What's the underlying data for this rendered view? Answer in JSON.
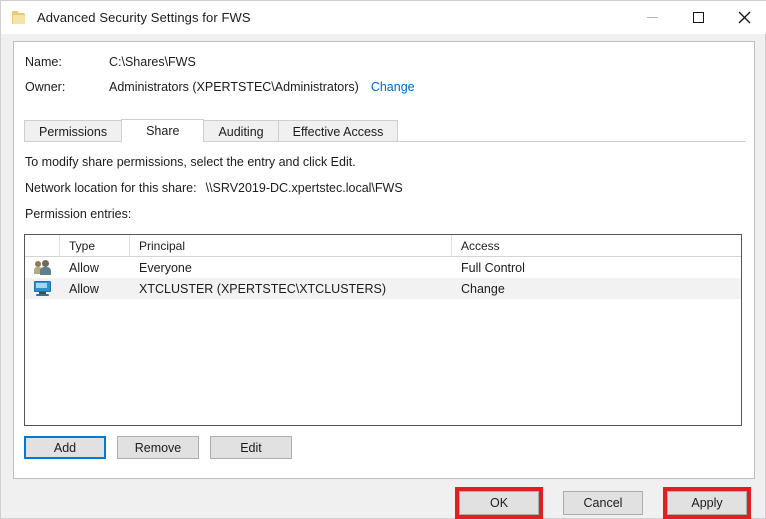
{
  "window": {
    "title": "Advanced Security Settings for FWS",
    "icon": "folder-icon",
    "controls": {
      "minimize": "minimize-icon",
      "maximize": "maximize-icon",
      "close": "close-icon"
    }
  },
  "info": {
    "name_label": "Name:",
    "name_value": "C:\\Shares\\FWS",
    "owner_label": "Owner:",
    "owner_value": "Administrators (XPERTSTEC\\Administrators)",
    "change_link": "Change"
  },
  "tabs": [
    {
      "label": "Permissions",
      "active": false
    },
    {
      "label": "Share",
      "active": true
    },
    {
      "label": "Auditing",
      "active": false
    },
    {
      "label": "Effective Access",
      "active": false
    }
  ],
  "body": {
    "instruction": "To modify share permissions, select the entry and click Edit.",
    "network_label": "Network location for this share:",
    "network_value": "\\\\SRV2019-DC.xpertstec.local\\FWS",
    "entries_label": "Permission entries:"
  },
  "table": {
    "columns": [
      "",
      "Type",
      "Principal",
      "Access"
    ],
    "rows": [
      {
        "icon": "group-icon",
        "type": "Allow",
        "principal": "Everyone",
        "access": "Full Control",
        "selected": false
      },
      {
        "icon": "computer-icon",
        "type": "Allow",
        "principal": "XTCLUSTER (XPERTSTEC\\XTCLUSTERS)",
        "access": "Change",
        "selected": true
      }
    ]
  },
  "entry_buttons": {
    "add": "Add",
    "remove": "Remove",
    "edit": "Edit"
  },
  "footer_buttons": {
    "ok": "OK",
    "cancel": "Cancel",
    "apply": "Apply"
  },
  "colors": {
    "link": "#0066cc",
    "focus": "#0078d7",
    "annotation": "#e02020",
    "selected_row": "#f2f2f2"
  }
}
